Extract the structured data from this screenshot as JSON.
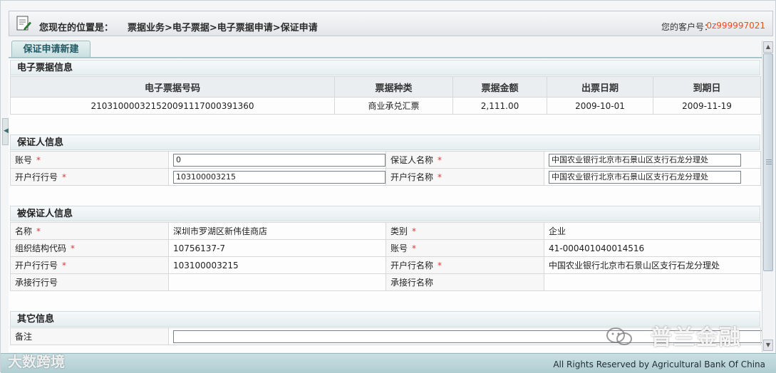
{
  "header": {
    "location_prefix": "您现在的位置是：",
    "location_path": "票据业务>电子票据>电子票据申请>保证申请",
    "customer_label": "您的客户号：",
    "customer_no": "0z999997021"
  },
  "tab": {
    "label": "保证申请新建"
  },
  "bill_section": {
    "title": "电子票据信息",
    "headers": [
      "电子票据号码",
      "票据种类",
      "票据金额",
      "出票日期",
      "到期日"
    ],
    "row": [
      "210310000321520091117000391360",
      "商业承兑汇票",
      "2,111.00",
      "2009-10-01",
      "2009-11-19"
    ]
  },
  "guarantor_section": {
    "title": "保证人信息",
    "account_label": "账号",
    "account_value": "0",
    "name_label": "保证人名称",
    "name_value": "中国农业银行北京市石景山区支行石龙分理处",
    "bank_no_label": "开户行行号",
    "bank_no_value": "103100003215",
    "bank_name_label": "开户行名称",
    "bank_name_value": "中国农业银行北京市石景山区支行石龙分理处"
  },
  "guaranteed_section": {
    "title": "被保证人信息",
    "name_label": "名称",
    "name_value": "深圳市罗湖区新伟佳商店",
    "type_label": "类别",
    "type_value": "企业",
    "org_code_label": "组织结构代码",
    "org_code_value": "10756137-7",
    "account_label": "账号",
    "account_value": "41-000401040014516",
    "bank_no_label": "开户行行号",
    "bank_no_value": "103100003215",
    "bank_name_label": "开户行名称",
    "bank_name_value": "中国农业银行北京市石景山区支行石龙分理处",
    "acceptor_no_label": "承接行行号",
    "acceptor_no_value": "",
    "acceptor_name_label": "承接行名称",
    "acceptor_name_value": ""
  },
  "other_section": {
    "title": "其它信息",
    "remark_label": "备注",
    "remark_value": ""
  },
  "required_mark": "*",
  "footer": {
    "copyright": "All Rights Reserved by Agricultural Bank Of China"
  },
  "watermarks": {
    "left": "大数跨境",
    "right": "普兰金融"
  },
  "colors": {
    "accent": "#235a66",
    "customer_no": "#e8501a",
    "required": "#d63b3b",
    "footer": "#b0cdd2"
  }
}
